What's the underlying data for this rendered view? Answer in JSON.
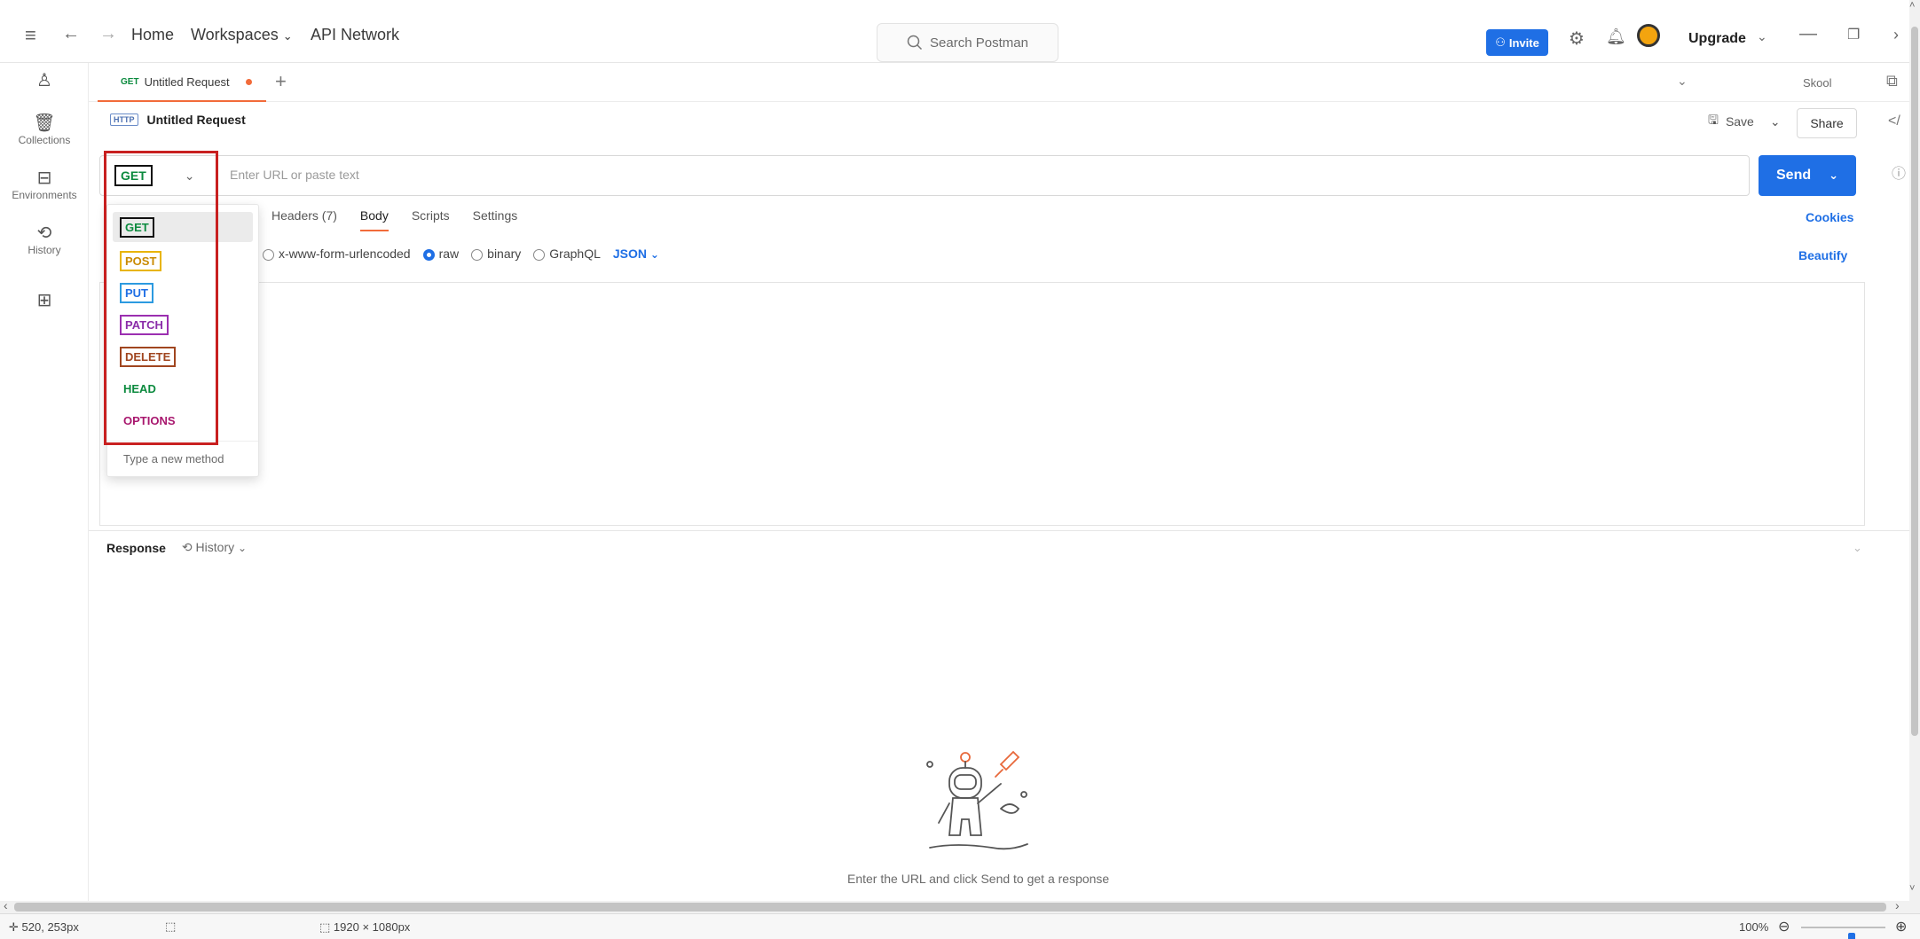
{
  "topbar": {
    "nav": [
      "Home",
      "Workspaces",
      "API Network"
    ],
    "search_placeholder": "Search Postman",
    "invite_label": "Invite",
    "upgrade_label": "Upgrade"
  },
  "sidebar": {
    "items": [
      {
        "label": "",
        "icon": "user-icon"
      },
      {
        "label": "Collections",
        "icon": "collections-icon"
      },
      {
        "label": "Environments",
        "icon": "environments-icon"
      },
      {
        "label": "History",
        "icon": "history-icon"
      },
      {
        "label": "",
        "icon": "apps-icon"
      }
    ]
  },
  "tabs": {
    "active_tab_method": "GET",
    "active_tab_title": "Untitled Request",
    "environment": "Skool"
  },
  "request": {
    "title": "Untitled Request",
    "http_badge": "HTTP",
    "save_label": "Save",
    "share_label": "Share",
    "method": "GET",
    "url_placeholder": "Enter URL or paste text",
    "send_label": "Send",
    "subtabs": [
      "Headers (7)",
      "Body",
      "Scripts",
      "Settings"
    ],
    "active_subtab": "Body",
    "cookies_label": "Cookies",
    "body_types": [
      "x-www-form-urlencoded",
      "raw",
      "binary",
      "GraphQL"
    ],
    "selected_body_type": "raw",
    "body_format": "JSON",
    "beautify_label": "Beautify"
  },
  "method_dropdown": {
    "options": [
      {
        "label": "GET",
        "color": "#0b8a3e",
        "outline": "#111111"
      },
      {
        "label": "POST",
        "color": "#c98a00",
        "outline": "#e8b400"
      },
      {
        "label": "PUT",
        "color": "#1f6fe5",
        "outline": "#2c9ae0"
      },
      {
        "label": "PATCH",
        "color": "#8a2da8",
        "outline": "#9b2fb0"
      },
      {
        "label": "DELETE",
        "color": "#a0451f",
        "outline": "#a0451f"
      },
      {
        "label": "HEAD",
        "color": "#0b8a3e",
        "outline": ""
      },
      {
        "label": "OPTIONS",
        "color": "#a8176e",
        "outline": ""
      }
    ],
    "new_method_placeholder": "Type a new method"
  },
  "response": {
    "label": "Response",
    "history_label": "History",
    "empty_message": "Enter the URL and click Send to get a response"
  },
  "status_bar": {
    "cursor_pos": "520, 253px",
    "dimensions": "1920 × 1080px",
    "zoom": "100%",
    "zoom_level": 0.6
  }
}
